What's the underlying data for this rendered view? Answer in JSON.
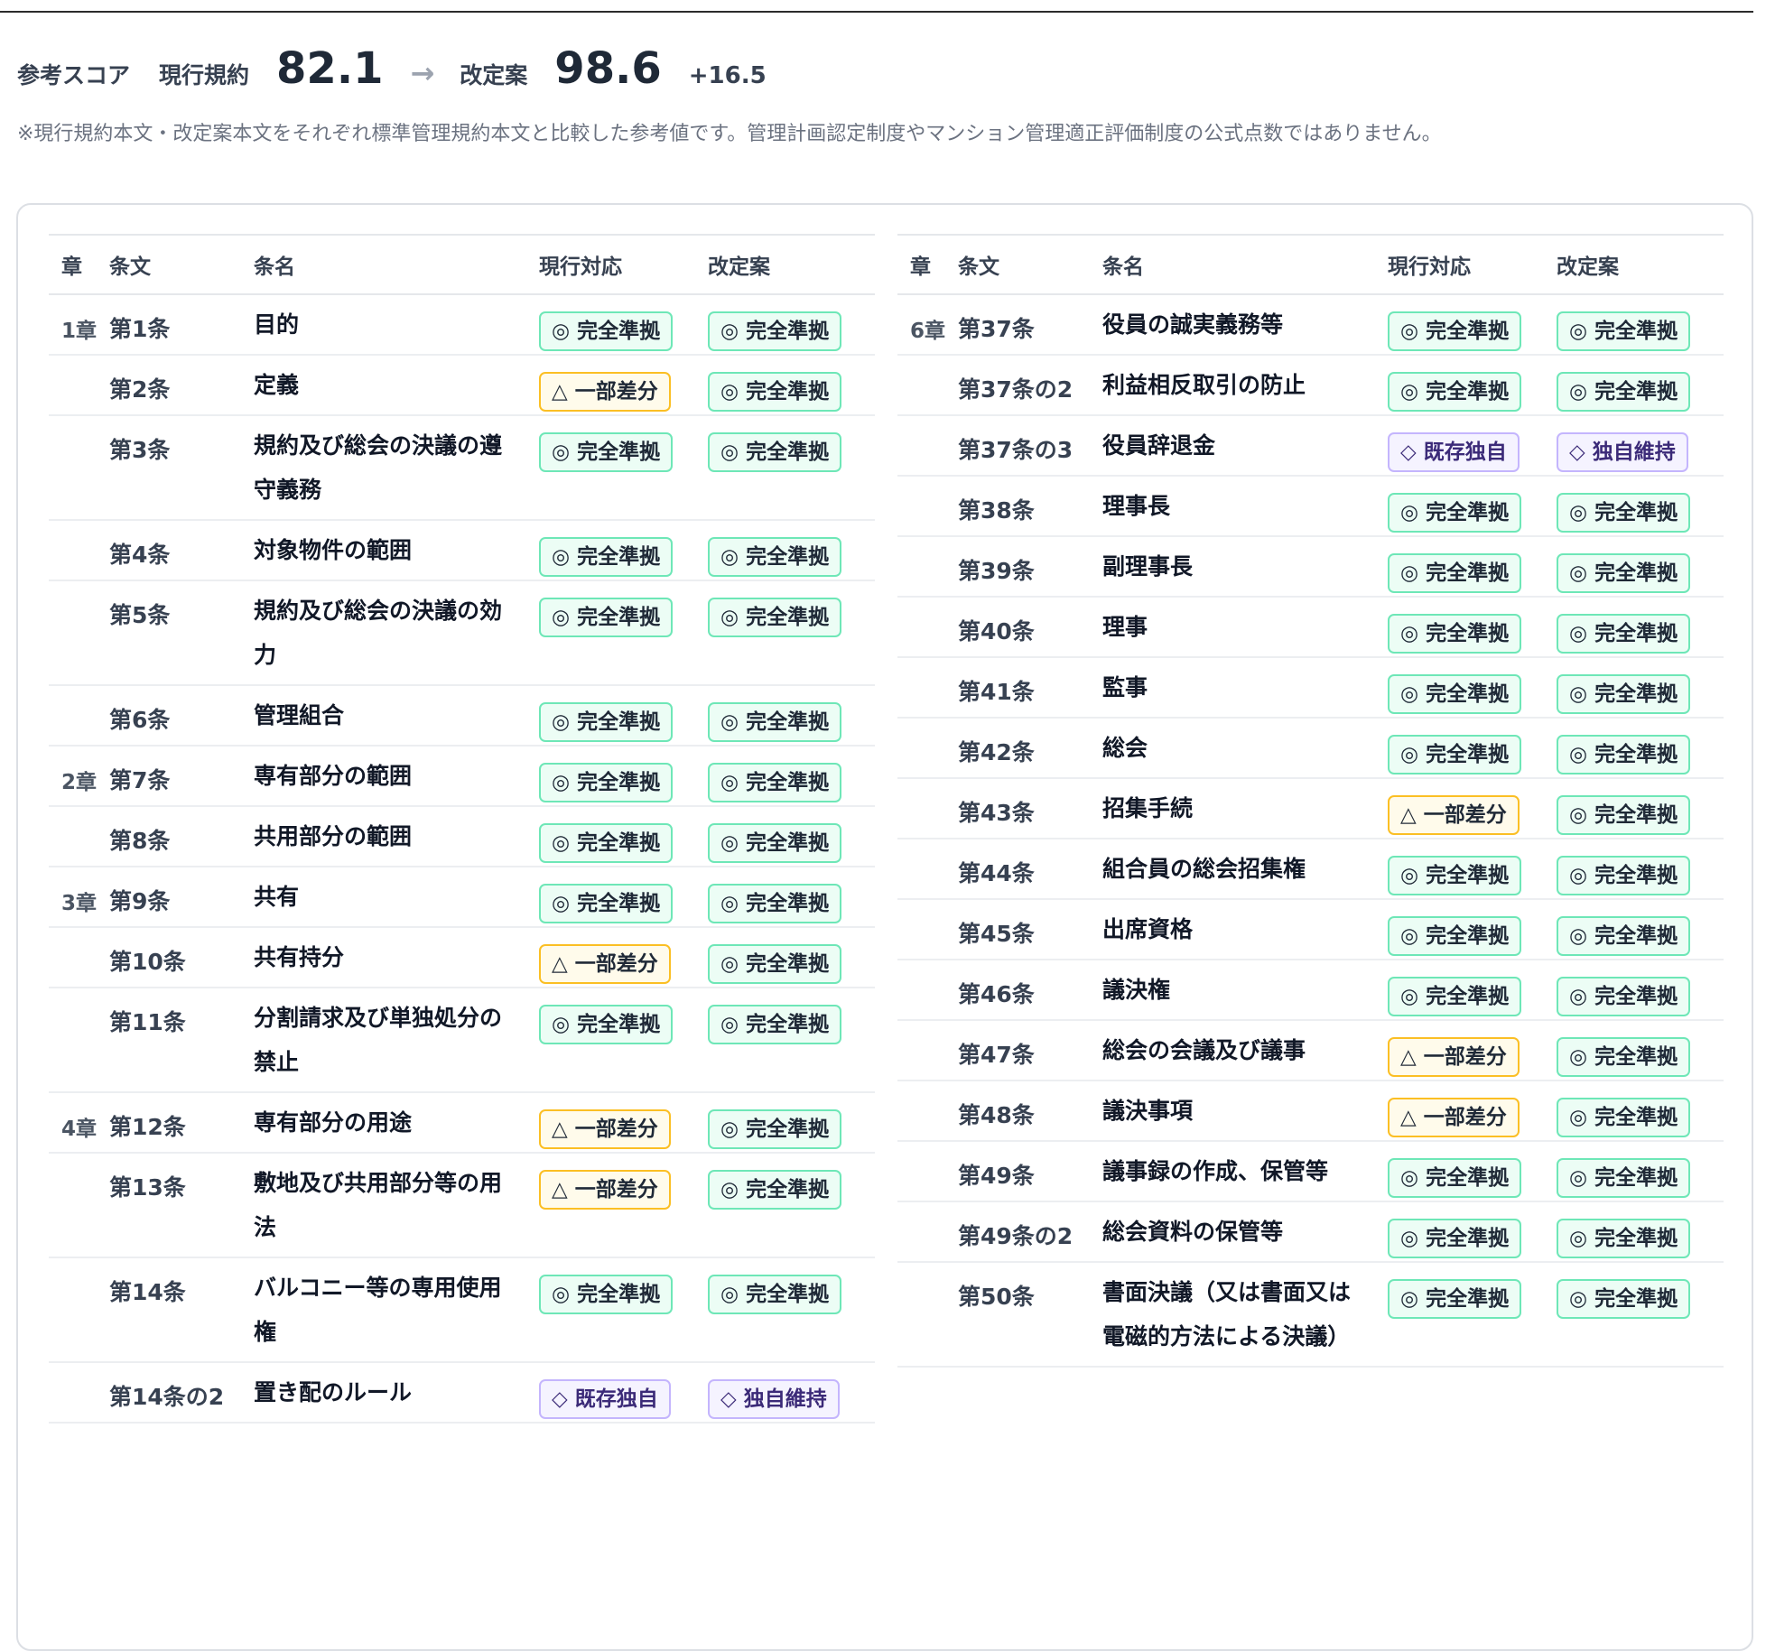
{
  "score": {
    "title": "参考スコア",
    "current_label": "現行規約",
    "current_value": "82.1",
    "arrow": "→",
    "revised_label": "改定案",
    "revised_value": "98.6",
    "delta": "+16.5"
  },
  "note": "※現行規約本文・改定案本文をそれぞれ標準管理規約本文と比較した参考値です。管理計画認定制度やマンション管理適正評価制度の公式点数ではありません。",
  "columns": {
    "chapter": "章",
    "article": "条文",
    "name": "条名",
    "current": "現行対応",
    "revised": "改定案"
  },
  "status_colors": {
    "full": "#6ee7b7",
    "partial": "#fbbf24",
    "unique": "#c4b5fd"
  },
  "left_rows": [
    {
      "chapter": "1章",
      "article": "第1条",
      "name": "目的",
      "cur": "◎ 完全準拠",
      "cur_type": "full",
      "rev": "◎ 完全準拠",
      "rev_type": "full"
    },
    {
      "chapter": "",
      "article": "第2条",
      "name": "定義",
      "cur": "△ 一部差分",
      "cur_type": "partial",
      "rev": "◎ 完全準拠",
      "rev_type": "full"
    },
    {
      "chapter": "",
      "article": "第3条",
      "name": "規約及び総会の決議の遵守義務",
      "cur": "◎ 完全準拠",
      "cur_type": "full",
      "rev": "◎ 完全準拠",
      "rev_type": "full"
    },
    {
      "chapter": "",
      "article": "第4条",
      "name": "対象物件の範囲",
      "cur": "◎ 完全準拠",
      "cur_type": "full",
      "rev": "◎ 完全準拠",
      "rev_type": "full"
    },
    {
      "chapter": "",
      "article": "第5条",
      "name": "規約及び総会の決議の効力",
      "cur": "◎ 完全準拠",
      "cur_type": "full",
      "rev": "◎ 完全準拠",
      "rev_type": "full"
    },
    {
      "chapter": "",
      "article": "第6条",
      "name": "管理組合",
      "cur": "◎ 完全準拠",
      "cur_type": "full",
      "rev": "◎ 完全準拠",
      "rev_type": "full"
    },
    {
      "chapter": "2章",
      "article": "第7条",
      "name": "専有部分の範囲",
      "cur": "◎ 完全準拠",
      "cur_type": "full",
      "rev": "◎ 完全準拠",
      "rev_type": "full"
    },
    {
      "chapter": "",
      "article": "第8条",
      "name": "共用部分の範囲",
      "cur": "◎ 完全準拠",
      "cur_type": "full",
      "rev": "◎ 完全準拠",
      "rev_type": "full"
    },
    {
      "chapter": "3章",
      "article": "第9条",
      "name": "共有",
      "cur": "◎ 完全準拠",
      "cur_type": "full",
      "rev": "◎ 完全準拠",
      "rev_type": "full"
    },
    {
      "chapter": "",
      "article": "第10条",
      "name": "共有持分",
      "cur": "△ 一部差分",
      "cur_type": "partial",
      "rev": "◎ 完全準拠",
      "rev_type": "full"
    },
    {
      "chapter": "",
      "article": "第11条",
      "name": "分割請求及び単独処分の禁止",
      "cur": "◎ 完全準拠",
      "cur_type": "full",
      "rev": "◎ 完全準拠",
      "rev_type": "full"
    },
    {
      "chapter": "4章",
      "article": "第12条",
      "name": "専有部分の用途",
      "cur": "△ 一部差分",
      "cur_type": "partial",
      "rev": "◎ 完全準拠",
      "rev_type": "full"
    },
    {
      "chapter": "",
      "article": "第13条",
      "name": "敷地及び共用部分等の用法",
      "cur": "△ 一部差分",
      "cur_type": "partial",
      "rev": "◎ 完全準拠",
      "rev_type": "full"
    },
    {
      "chapter": "",
      "article": "第14条",
      "name": "バルコニー等の専用使用権",
      "cur": "◎ 完全準拠",
      "cur_type": "full",
      "rev": "◎ 完全準拠",
      "rev_type": "full"
    },
    {
      "chapter": "",
      "article": "第14条の2",
      "name": "置き配のルール",
      "cur": "◇ 既存独自",
      "cur_type": "unique",
      "rev": "◇ 独自維持",
      "rev_type": "unique"
    }
  ],
  "right_rows": [
    {
      "chapter": "6章",
      "article": "第37条",
      "name": "役員の誠実義務等",
      "cur": "◎ 完全準拠",
      "cur_type": "full",
      "rev": "◎ 完全準拠",
      "rev_type": "full"
    },
    {
      "chapter": "",
      "article": "第37条の2",
      "name": "利益相反取引の防止",
      "cur": "◎ 完全準拠",
      "cur_type": "full",
      "rev": "◎ 完全準拠",
      "rev_type": "full"
    },
    {
      "chapter": "",
      "article": "第37条の3",
      "name": "役員辞退金",
      "cur": "◇ 既存独自",
      "cur_type": "unique",
      "rev": "◇ 独自維持",
      "rev_type": "unique"
    },
    {
      "chapter": "",
      "article": "第38条",
      "name": "理事長",
      "cur": "◎ 完全準拠",
      "cur_type": "full",
      "rev": "◎ 完全準拠",
      "rev_type": "full"
    },
    {
      "chapter": "",
      "article": "第39条",
      "name": "副理事長",
      "cur": "◎ 完全準拠",
      "cur_type": "full",
      "rev": "◎ 完全準拠",
      "rev_type": "full"
    },
    {
      "chapter": "",
      "article": "第40条",
      "name": "理事",
      "cur": "◎ 完全準拠",
      "cur_type": "full",
      "rev": "◎ 完全準拠",
      "rev_type": "full"
    },
    {
      "chapter": "",
      "article": "第41条",
      "name": "監事",
      "cur": "◎ 完全準拠",
      "cur_type": "full",
      "rev": "◎ 完全準拠",
      "rev_type": "full"
    },
    {
      "chapter": "",
      "article": "第42条",
      "name": "総会",
      "cur": "◎ 完全準拠",
      "cur_type": "full",
      "rev": "◎ 完全準拠",
      "rev_type": "full"
    },
    {
      "chapter": "",
      "article": "第43条",
      "name": "招集手続",
      "cur": "△ 一部差分",
      "cur_type": "partial",
      "rev": "◎ 完全準拠",
      "rev_type": "full"
    },
    {
      "chapter": "",
      "article": "第44条",
      "name": "組合員の総会招集権",
      "cur": "◎ 完全準拠",
      "cur_type": "full",
      "rev": "◎ 完全準拠",
      "rev_type": "full"
    },
    {
      "chapter": "",
      "article": "第45条",
      "name": "出席資格",
      "cur": "◎ 完全準拠",
      "cur_type": "full",
      "rev": "◎ 完全準拠",
      "rev_type": "full"
    },
    {
      "chapter": "",
      "article": "第46条",
      "name": "議決権",
      "cur": "◎ 完全準拠",
      "cur_type": "full",
      "rev": "◎ 完全準拠",
      "rev_type": "full"
    },
    {
      "chapter": "",
      "article": "第47条",
      "name": "総会の会議及び議事",
      "cur": "△ 一部差分",
      "cur_type": "partial",
      "rev": "◎ 完全準拠",
      "rev_type": "full"
    },
    {
      "chapter": "",
      "article": "第48条",
      "name": "議決事項",
      "cur": "△ 一部差分",
      "cur_type": "partial",
      "rev": "◎ 完全準拠",
      "rev_type": "full"
    },
    {
      "chapter": "",
      "article": "第49条",
      "name": "議事録の作成、保管等",
      "cur": "◎ 完全準拠",
      "cur_type": "full",
      "rev": "◎ 完全準拠",
      "rev_type": "full"
    },
    {
      "chapter": "",
      "article": "第49条の2",
      "name": "総会資料の保管等",
      "cur": "◎ 完全準拠",
      "cur_type": "full",
      "rev": "◎ 完全準拠",
      "rev_type": "full"
    },
    {
      "chapter": "",
      "article": "第50条",
      "name": "書面決議（又は書面又は電磁的方法による決議）",
      "cur": "◎ 完全準拠",
      "cur_type": "full",
      "rev": "◎ 完全準拠",
      "rev_type": "full"
    }
  ]
}
